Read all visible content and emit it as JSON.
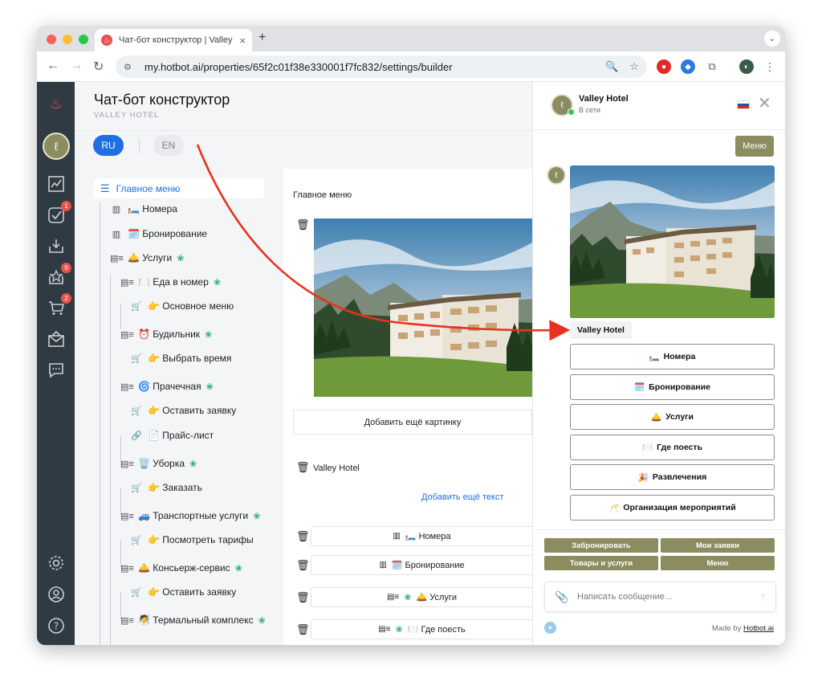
{
  "browser": {
    "tab_title": "Чат-бот конструктор | Valley",
    "tab_close": "×",
    "new_tab": "+",
    "url": "my.hotbot.ai/properties/65f2c01f38e330001f7fc832/settings/builder"
  },
  "rail": {
    "badges": {
      "tasks": "1",
      "inbox": "9",
      "cart": "2"
    }
  },
  "header": {
    "title": "Чат-бот конструктор",
    "subtitle": "VALLEY HOTEL"
  },
  "languages": {
    "ru": "RU",
    "en": "EN"
  },
  "tree": {
    "root": "Главное меню",
    "items": [
      {
        "icon": "▥",
        "label": "🛏️ Номера",
        "ai": false
      },
      {
        "icon": "▥",
        "label": "🗓️ Бронирование",
        "ai": false
      },
      {
        "icon": "▤≡",
        "label": "🛎️ Услуги",
        "ai": true
      },
      {
        "icon": "▤≡",
        "label": "🍽️ Еда в номер",
        "ai": true
      },
      {
        "icon": "🛒",
        "label": "👉 Основное меню",
        "ai": false
      },
      {
        "icon": "▤≡",
        "label": "⏰ Будильник",
        "ai": true
      },
      {
        "icon": "🛒",
        "label": "👉 Выбрать время",
        "ai": false
      },
      {
        "icon": "▤≡",
        "label": "🌀 Прачечная",
        "ai": true
      },
      {
        "icon": "🛒",
        "label": "👉 Оставить заявку",
        "ai": false
      },
      {
        "icon": "🔗",
        "label": "📄 Прайс-лист",
        "ai": false
      },
      {
        "icon": "▤≡",
        "label": "🗑️ Уборка",
        "ai": true
      },
      {
        "icon": "🛒",
        "label": "👉 Заказать",
        "ai": false
      },
      {
        "icon": "▤≡",
        "label": "🚙 Транспортные услуги",
        "ai": true
      },
      {
        "icon": "🛒",
        "label": "👉 Посмотреть тарифы",
        "ai": false
      },
      {
        "icon": "▤≡",
        "label": "🛎️ Консьерж-сервис",
        "ai": true
      },
      {
        "icon": "🛒",
        "label": "👉 Оставить заявку",
        "ai": false
      },
      {
        "icon": "▤≡",
        "label": "🧖 Термальный комплекс",
        "ai": true
      }
    ]
  },
  "editor": {
    "section_label": "Главное меню",
    "add_picture": "Добавить ещё картинку",
    "text_block": "Valley Hotel",
    "add_text": "Добавить ещё текст",
    "buttons": [
      {
        "icon": "▥",
        "label": "🛏️ Номера",
        "ai": false
      },
      {
        "icon": "▥",
        "label": "🗓️ Бронирование",
        "ai": false
      },
      {
        "icon": "▤≡",
        "label": "🛎️ Услуги",
        "ai": true
      },
      {
        "icon": "▤≡",
        "label": "🍽️ Где поесть",
        "ai": true
      }
    ]
  },
  "chat": {
    "name": "Valley Hotel",
    "status": "В сети",
    "menu_button": "Меню",
    "bubble": "Valley Hotel",
    "options": [
      {
        "icon": "🛏️",
        "label": "Номера"
      },
      {
        "icon": "🗓️",
        "label": "Бронирование"
      },
      {
        "icon": "🛎️",
        "label": "Услуги"
      },
      {
        "icon": "🍽️",
        "label": "Где поесть"
      },
      {
        "icon": "🎉",
        "label": "Развлечения"
      },
      {
        "icon": "🥂",
        "label": "Организация мероприятий"
      }
    ],
    "quick": [
      "Забронировать",
      "Мои заявки",
      "Товары и услуги",
      "Меню"
    ],
    "placeholder": "Написать сообщение...",
    "made_by_prefix": "Made by",
    "made_by_link": "Hotbot.ai"
  },
  "colors": {
    "accent": "#1f6fe0",
    "olive": "#8b8c5f",
    "rail": "#2f3a43",
    "badge": "#e8524a",
    "arrow": "#e8321e",
    "ai_icon": "#27b06a"
  }
}
